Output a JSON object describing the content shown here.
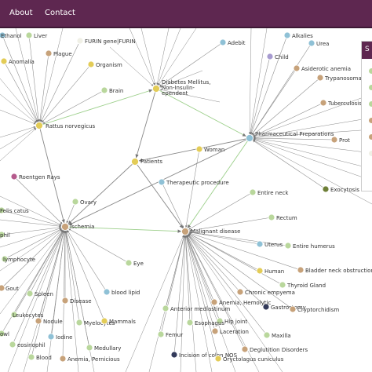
{
  "nav": {
    "about": "About",
    "contact": "Contact"
  },
  "panel": {
    "head_text": "S"
  },
  "colors": {
    "navbar": "#5e2750",
    "edge": "#888888",
    "edge_highlight": "#9ccf8a",
    "node_green": "#b9d79c",
    "node_tan": "#c7a27a",
    "node_yellow": "#e3cc57",
    "node_blue": "#8fc1d6",
    "node_purple": "#a79bd0",
    "node_magenta": "#b55a8c",
    "node_olive": "#6e7f37",
    "node_navy": "#333a5a",
    "node_white": "#f0f0e6"
  },
  "swatches": [
    "green",
    "green",
    "green",
    "tan",
    "tan",
    "white"
  ],
  "hubs": [
    {
      "id": "rattus",
      "label": "Rattus norvegicus"
    },
    {
      "id": "diabetes",
      "label": "Diabetes Mellitus, Non-Insulin-Dependent"
    },
    {
      "id": "pharma",
      "label": "Pharmaceutical Preparations"
    },
    {
      "id": "ischemia",
      "label": "Ischemia"
    },
    {
      "id": "malignant",
      "label": "Malignant disease"
    },
    {
      "id": "patients",
      "label": "Patients"
    }
  ],
  "nodes": [
    {
      "label": "Ethanol",
      "color": "blue",
      "hub": "rattus"
    },
    {
      "label": "Liver",
      "color": "green",
      "hub": "rattus"
    },
    {
      "label": "Plague",
      "color": "tan",
      "hub": "rattus"
    },
    {
      "label": "Anomalia",
      "color": "yellow",
      "hub": "rattus"
    },
    {
      "label": "FURIN gene|FURIN",
      "color": "white",
      "hub": "rattus"
    },
    {
      "label": "Organism",
      "color": "yellow",
      "hub": "rattus"
    },
    {
      "label": "Brain",
      "color": "green",
      "hub": "rattus"
    },
    {
      "label": "Adebit",
      "color": "blue",
      "hub": "diabetes"
    },
    {
      "label": "Alkalies",
      "color": "blue",
      "hub": "pharma"
    },
    {
      "label": "Urea",
      "color": "blue",
      "hub": "pharma"
    },
    {
      "label": "Child",
      "color": "purple",
      "hub": "pharma"
    },
    {
      "label": "Asiderotic anemia",
      "color": "tan",
      "hub": "pharma"
    },
    {
      "label": "Trypanosoma",
      "color": "tan",
      "hub": "pharma"
    },
    {
      "label": "Tuberculosis, Pulmonary",
      "color": "tan",
      "hub": "pharma"
    },
    {
      "label": "Prot",
      "color": "tan",
      "hub": "pharma"
    },
    {
      "label": "Exocytosis",
      "color": "olive",
      "hub": "pharma"
    },
    {
      "label": "Woman",
      "color": "yellow",
      "hub": "malignant"
    },
    {
      "label": "Therapeutic procedure",
      "color": "blue",
      "hub": "malignant"
    },
    {
      "label": "Entire neck",
      "color": "green",
      "hub": "malignant"
    },
    {
      "label": "Rectum",
      "color": "green",
      "hub": "malignant"
    },
    {
      "label": "Roentgen Rays",
      "color": "magenta",
      "hub": "ischemia"
    },
    {
      "label": "Ovary",
      "color": "green",
      "hub": "ischemia"
    },
    {
      "label": "Felis catus",
      "color": "green",
      "hub": "ischemia"
    },
    {
      "label": "Uterus",
      "color": "blue",
      "hub": "malignant"
    },
    {
      "label": "Entire humerus",
      "color": "green",
      "hub": "malignant"
    },
    {
      "label": "Eye",
      "color": "green",
      "hub": "ischemia"
    },
    {
      "label": "Human",
      "color": "yellow",
      "hub": "malignant"
    },
    {
      "label": "Bladder neck obstruction",
      "color": "tan",
      "hub": "malignant"
    },
    {
      "label": "Thyroid Gland",
      "color": "green",
      "hub": "malignant"
    },
    {
      "label": "Chronic empyema",
      "color": "tan",
      "hub": "malignant"
    },
    {
      "label": "Gastrostomy",
      "color": "navy",
      "hub": "malignant"
    },
    {
      "label": "Cryptorchidism",
      "color": "tan",
      "hub": "malignant"
    },
    {
      "label": "Anemia, Hemolytic",
      "color": "tan",
      "hub": "malignant"
    },
    {
      "label": "Anterior mediastinum",
      "color": "green",
      "hub": "malignant"
    },
    {
      "label": "Hip joint",
      "color": "green",
      "hub": "malignant"
    },
    {
      "label": "Esophagus",
      "color": "green",
      "hub": "malignant"
    },
    {
      "label": "Maxilla",
      "color": "green",
      "hub": "malignant"
    },
    {
      "label": "Laceration",
      "color": "tan",
      "hub": "malignant"
    },
    {
      "label": "Femur",
      "color": "green",
      "hub": "malignant"
    },
    {
      "label": "Deglutition Disorders",
      "color": "tan",
      "hub": "malignant"
    },
    {
      "label": "Incision of colon NOS",
      "color": "navy",
      "hub": "malignant"
    },
    {
      "label": "Oryctolagus cuniculus",
      "color": "yellow",
      "hub": "malignant"
    },
    {
      "label": "Gout",
      "color": "tan",
      "hub": "ischemia"
    },
    {
      "label": "Spleen",
      "color": "green",
      "hub": "ischemia"
    },
    {
      "label": "Disease",
      "color": "tan",
      "hub": "ischemia"
    },
    {
      "label": "blood lipid",
      "color": "blue",
      "hub": "ischemia"
    },
    {
      "label": "Leukocytes",
      "color": "green",
      "hub": "ischemia"
    },
    {
      "label": "Nodule",
      "color": "tan",
      "hub": "ischemia"
    },
    {
      "label": "Myelocytes",
      "color": "green",
      "hub": "ischemia"
    },
    {
      "label": "Mammals",
      "color": "yellow",
      "hub": "ischemia"
    },
    {
      "label": "eosinophil",
      "color": "green",
      "hub": "ischemia"
    },
    {
      "label": "Iodine",
      "color": "blue",
      "hub": "ischemia"
    },
    {
      "label": "Medullary",
      "color": "green",
      "hub": "ischemia"
    },
    {
      "label": "Blood",
      "color": "green",
      "hub": "ischemia"
    },
    {
      "label": "Anemia, Pernicious",
      "color": "tan",
      "hub": "ischemia"
    },
    {
      "label": "lymphocyte",
      "color": "green",
      "hub": "ischemia"
    },
    {
      "label": "phil",
      "color": "green",
      "hub": "ischemia"
    },
    {
      "label": "owl",
      "color": "green",
      "hub": "ischemia"
    }
  ]
}
